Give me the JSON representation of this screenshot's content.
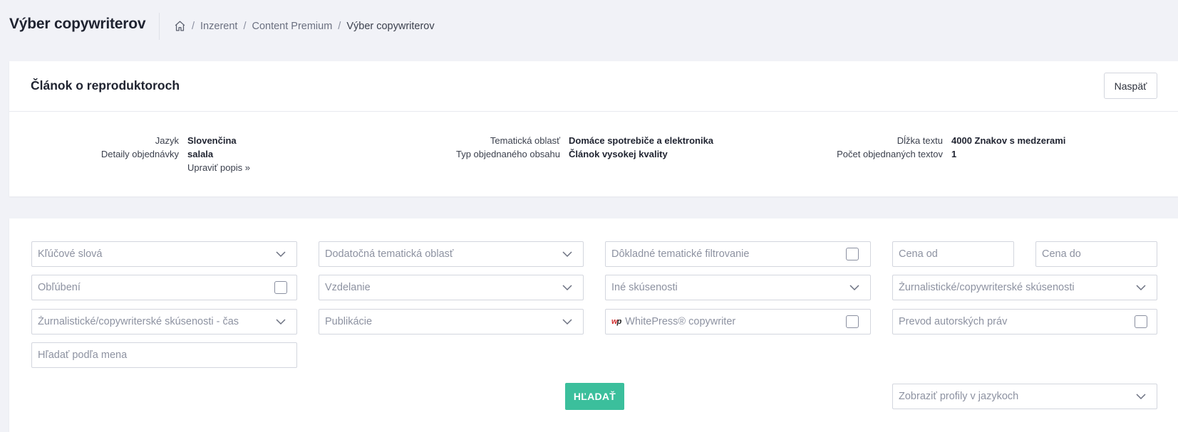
{
  "header": {
    "title": "Výber copywriterov",
    "breadcrumb": [
      "Inzerent",
      "Content Premium",
      "Výber copywriterov"
    ],
    "home_icon": "home-icon"
  },
  "order": {
    "title": "Článok o reproduktoroch",
    "back_label": "Naspäť",
    "details": {
      "language_label": "Jazyk",
      "language_value": "Slovenčina",
      "order_details_label": "Detaily objednávky",
      "order_details_value": "salala",
      "edit_description_link": "Upraviť popis »",
      "topic_label": "Tematická oblasť",
      "topic_value": "Domáce spotrebiče a elektronika",
      "content_type_label": "Typ objednaného obsahu",
      "content_type_value": "Článok vysokej kvality",
      "length_label": "Dĺžka textu",
      "length_value": "4000 Znakov s medzerami",
      "count_label": "Počet objednaných textov",
      "count_value": "1"
    }
  },
  "filters": {
    "keywords": "Kľúčové slová",
    "additional_topic": "Dodatočná tematická oblasť",
    "thorough_filtering": "Dôkladné tematické filtrovanie",
    "price_from": "Cena od",
    "price_to": "Cena do",
    "favourites": "Obľúbení",
    "education": "Vzdelanie",
    "other_experience": "Iné skúsenosti",
    "journalist_experience": "Žurnalistické/copywriterské skúsenosti",
    "journalist_experience_time": "Žurnalistické/copywriterské skúsenosti - čas",
    "publications": "Publikácie",
    "whitepress_copywriter": "WhitePress® copywriter",
    "copyright_transfer": "Prevod autorských práv",
    "search_by_name": "Hľadať podľa mena",
    "search_button": "HĽADAŤ",
    "show_profiles_languages": "Zobraziť profily v jazykoch"
  },
  "colors": {
    "accent": "#3bbf9c",
    "background": "#f1f2f7"
  }
}
